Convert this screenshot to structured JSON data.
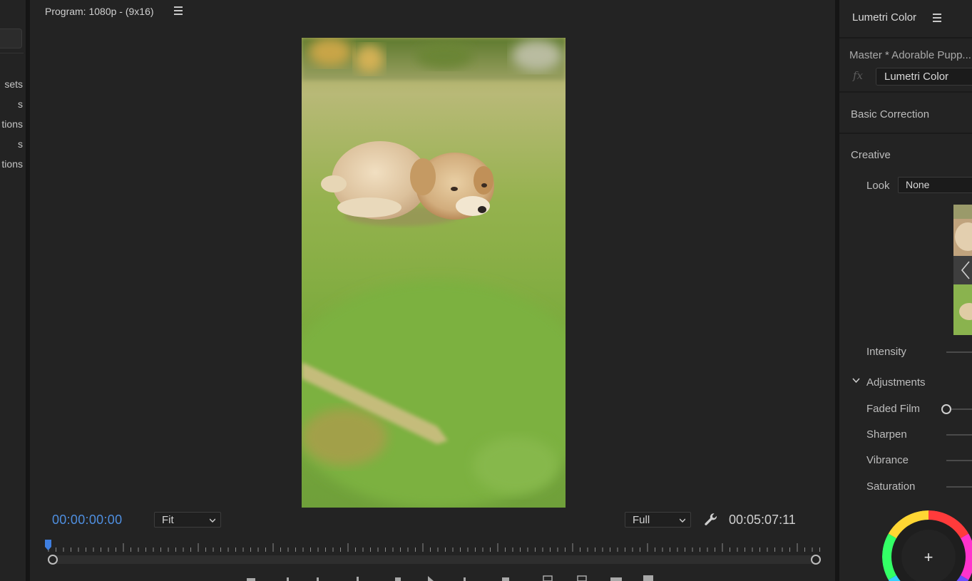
{
  "left_panel": {
    "items": [
      "sets",
      "s",
      "tions",
      "s",
      "tions"
    ]
  },
  "program_monitor": {
    "title": "Program: 1080p - (9x16)",
    "current_timecode": "00:00:00:00",
    "zoom_value": "Fit",
    "resolution_value": "Full",
    "duration_timecode": "00:05:07:11",
    "playhead_position": 0
  },
  "lumetri": {
    "title": "Lumetri Color",
    "clip_label": "Master * Adorable Pupp...",
    "fx_label": "fx",
    "effect_name": "Lumetri Color",
    "section_basic": "Basic Correction",
    "section_creative": "Creative",
    "look_label": "Look",
    "look_value": "None",
    "intensity_label": "Intensity",
    "adjustments_label": "Adjustments",
    "faded_film_label": "Faded Film",
    "faded_film_value": 0,
    "sharpen_label": "Sharpen",
    "vibrance_label": "Vibrance",
    "saturation_label": "Saturation",
    "wheel_plus": "+"
  },
  "colors": {
    "accent_timecode": "#4f8fe0",
    "panel_bg": "#232323",
    "divider": "#151515"
  },
  "icons": [
    "menu-icon",
    "chevron-down-icon",
    "wrench-icon",
    "playhead-icon",
    "chevron-left-icon",
    "plus-icon"
  ]
}
